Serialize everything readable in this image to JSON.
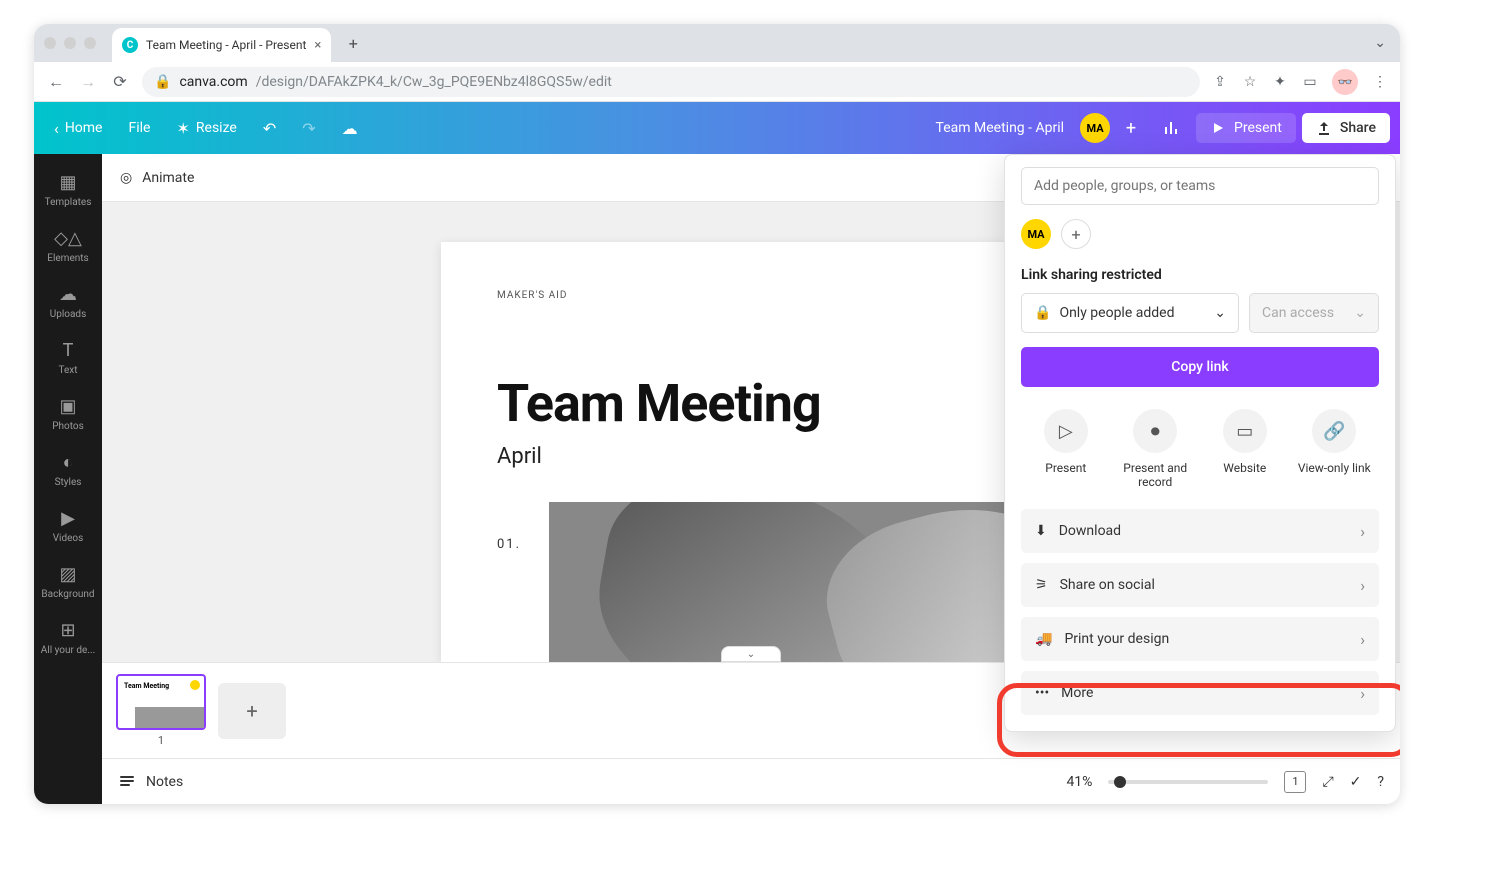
{
  "browser": {
    "tab_title": "Team Meeting - April - Present",
    "url_host": "canva.com",
    "url_path": "/design/DAFAkZPK4_k/Cw_3g_PQE9ENbz4l8GQS5w/edit"
  },
  "header": {
    "home": "Home",
    "file": "File",
    "resize": "Resize",
    "doc_title": "Team Meeting - April",
    "avatar_initials": "MA",
    "present": "Present",
    "share": "Share"
  },
  "sidebar": {
    "items": [
      {
        "icon": "templates",
        "label": "Templates"
      },
      {
        "icon": "elements",
        "label": "Elements"
      },
      {
        "icon": "uploads",
        "label": "Uploads"
      },
      {
        "icon": "text",
        "label": "Text"
      },
      {
        "icon": "photos",
        "label": "Photos"
      },
      {
        "icon": "styles",
        "label": "Styles"
      },
      {
        "icon": "videos",
        "label": "Videos"
      },
      {
        "icon": "background",
        "label": "Background"
      },
      {
        "icon": "allyour",
        "label": "All your de..."
      }
    ]
  },
  "subheader": {
    "animate": "Animate"
  },
  "slide": {
    "brand": "MAKER'S AID",
    "title": "Team Meeting",
    "subtitle": "April",
    "page_num": "01."
  },
  "thumbs": {
    "slide1_title": "Team Meeting",
    "slide1_num": "1"
  },
  "bottom": {
    "notes": "Notes",
    "zoom": "41%"
  },
  "share_panel": {
    "placeholder": "Add people, groups, or teams",
    "avatar_initials": "MA",
    "link_heading": "Link sharing restricted",
    "access_sel": "Only people added",
    "perm_sel": "Can access",
    "copy": "Copy link",
    "quick": [
      {
        "label": "Present"
      },
      {
        "label": "Present and record"
      },
      {
        "label": "Website"
      },
      {
        "label": "View-only link"
      }
    ],
    "list": [
      {
        "icon": "download",
        "label": "Download"
      },
      {
        "icon": "social",
        "label": "Share on social"
      },
      {
        "icon": "print",
        "label": "Print your design"
      },
      {
        "icon": "more",
        "label": "More"
      }
    ]
  }
}
